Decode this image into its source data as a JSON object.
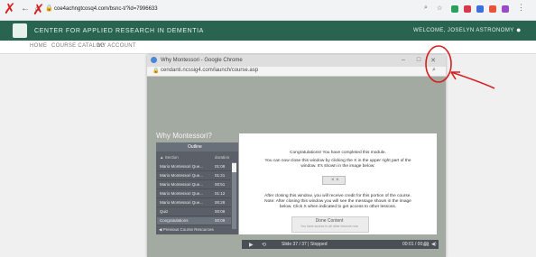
{
  "browser": {
    "url": "coe4achngtcosq4.com/bsnc-t/?id=7996633",
    "nav_back": "←",
    "nav_forward": "→",
    "nav_reload": "⌂",
    "lock": "🔒"
  },
  "site": {
    "title": "CENTER FOR APPLIED RESEARCH IN DEMENTIA",
    "user": "WELCOME, JOSELYN ASTRONOMY",
    "nav": [
      "HOME",
      "COURSE CATALOG",
      "MY ACCOUNT"
    ]
  },
  "popup": {
    "window_title": "Why Montessori - Google Chrome",
    "url": "cendanti.ncssig4.com/launch/course.asp",
    "minimize": "–",
    "maximize": "□",
    "close": "✕",
    "zoom_icon": "⌕"
  },
  "course": {
    "title": "Why Montessori?",
    "sidebar_tab": "Outline",
    "outline_header_title": "▲ Section",
    "outline_header_duration": "duration",
    "outline": [
      {
        "title": "Mario Montessori Que...",
        "duration": "01:08"
      },
      {
        "title": "Mario Montessori Que...",
        "duration": "01:21"
      },
      {
        "title": "Mario Montessori Que...",
        "duration": "00:51"
      },
      {
        "title": "Mario Montessori Que...",
        "duration": "01:12"
      },
      {
        "title": "Mario Montessori Que...",
        "duration": "00:28"
      },
      {
        "title": "Quiz",
        "duration": "00:08"
      },
      {
        "title": "Congratulations",
        "duration": "00:09"
      }
    ],
    "sidebar_footer": "◀ Previous   Course Resources"
  },
  "card": {
    "line1": "Congratulations! You have completed this module.",
    "line2": "You can now close this window by clicking the X in the upper right part of the",
    "line3": "window. It's shown in the image below:",
    "close_label": "× ×",
    "line4": "After closing this window, you will receive credit for this portion of the course.",
    "line5": "Note: After closing this window you will see the message shown in the image",
    "line6": "below. Click X when indicated to get access to other lessons.",
    "done_label": "Done Content",
    "done_sub": "You have access to all other lessons now"
  },
  "player": {
    "play": "▶",
    "rewind": "⟲",
    "slide_info": "Slide 37 / 37  |  Stopped",
    "time_info": "00:01 / 00:09",
    "cc": "CC",
    "volume": "◀)"
  },
  "annotations": {
    "x1": "✗",
    "x2": "✗",
    "color": "#d62020"
  },
  "colors": {
    "site_header": "#28644f",
    "stage": "#a3aaa1",
    "sidebar": "#5b6068"
  }
}
